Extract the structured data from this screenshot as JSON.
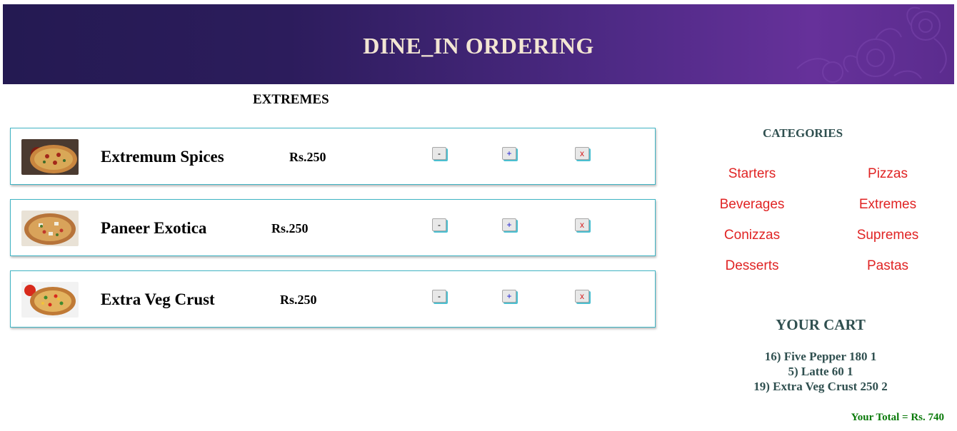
{
  "header": {
    "title": "DINE_IN ORDERING"
  },
  "section": {
    "title": "EXTREMES"
  },
  "items": [
    {
      "name": "Extremum Spices",
      "price": "Rs.250"
    },
    {
      "name": "Paneer Exotica",
      "price": "Rs.250"
    },
    {
      "name": "Extra Veg Crust",
      "price": "Rs.250"
    }
  ],
  "buttons": {
    "minus": "-",
    "plus": "+",
    "remove": "x"
  },
  "categories": {
    "title": "CATEGORIES",
    "items": [
      "Starters",
      "Pizzas",
      "Beverages",
      "Extremes",
      "Conizzas",
      "Supremes",
      "Desserts",
      "Pastas"
    ]
  },
  "cart": {
    "title": "YOUR CART",
    "lines": [
      "16) Five Pepper 180 1",
      "5) Latte 60 1",
      "19) Extra Veg Crust 250 2"
    ],
    "total": "Your Total = Rs. 740"
  },
  "colors": {
    "accent_link": "#e02424",
    "total_text": "#0a7a0a",
    "heading_text": "#2f4f4f",
    "header_gradient_start": "#241a52",
    "header_gradient_end": "#66319a",
    "card_border": "#40b4c4"
  }
}
